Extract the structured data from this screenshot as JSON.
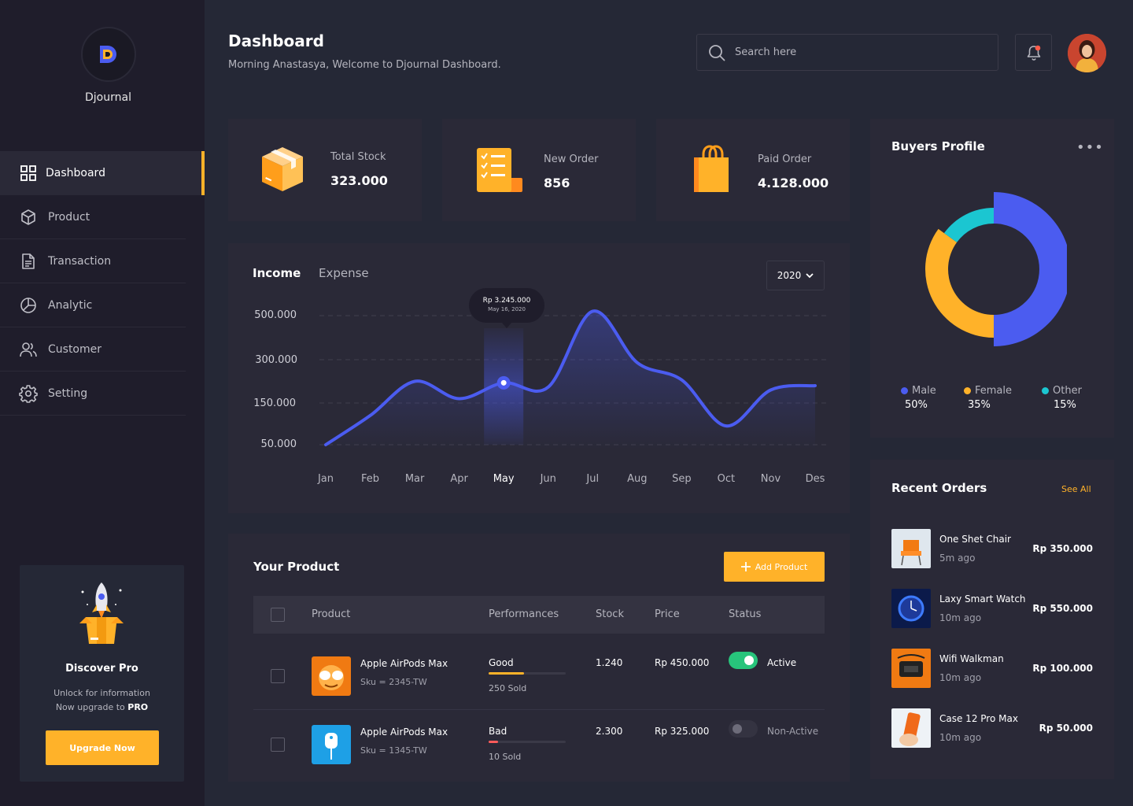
{
  "brand": {
    "name": "Djournal"
  },
  "sidebar": {
    "items": [
      {
        "label": "Dashboard",
        "icon": "grid-icon",
        "active": true
      },
      {
        "label": "Product",
        "icon": "box-icon"
      },
      {
        "label": "Transaction",
        "icon": "document-icon"
      },
      {
        "label": "Analytic",
        "icon": "pie-chart-icon"
      },
      {
        "label": "Customer",
        "icon": "users-icon"
      },
      {
        "label": "Setting",
        "icon": "gear-icon"
      }
    ],
    "promo": {
      "title": "Discover Pro",
      "line1": "Unlock for information",
      "line2_prefix": "Now upgrade to ",
      "line2_bold": "PRO",
      "button": "Upgrade Now"
    }
  },
  "header": {
    "title": "Dashboard",
    "welcome": "Morning Anastasya, Welcome to Djournal  Dashboard.",
    "search_placeholder": "Search here"
  },
  "stats": [
    {
      "label": "Total Stock",
      "value": "323.000",
      "icon": "box-icon"
    },
    {
      "label": "New Order",
      "value": "856",
      "icon": "checklist-icon"
    },
    {
      "label": "Paid Order",
      "value": "4.128.000",
      "icon": "shopping-bag-icon"
    }
  ],
  "income_chart": {
    "tabs": [
      "Income",
      "Expense"
    ],
    "year": "2020",
    "tooltip": {
      "value": "Rp 3.245.000",
      "date": "May 16, 2020"
    }
  },
  "chart_data": {
    "type": "line",
    "categories": [
      "Jan",
      "Feb",
      "Mar",
      "Apr",
      "May",
      "Jun",
      "Jul",
      "Aug",
      "Sep",
      "Oct",
      "Nov",
      "Des"
    ],
    "y_ticks": [
      "500.000",
      "300.000",
      "150.000",
      "50.000"
    ],
    "highlight": "May",
    "values": [
      50000,
      120000,
      225000,
      165000,
      220000,
      205000,
      520000,
      290000,
      230000,
      95000,
      195000,
      210000
    ],
    "grid": true,
    "colors": {
      "line": "#4b5cf0"
    }
  },
  "products": {
    "title": "Your Product",
    "add_button": "Add Product",
    "columns": [
      "Product",
      "Performances",
      "Stock",
      "Price",
      "Status"
    ],
    "rows": [
      {
        "name": "Apple AirPods Max",
        "sku": "Sku = 2345-TW",
        "performance": "Good",
        "performance_fraction": 0.46,
        "bar_color": "#ffb229",
        "sold": "250 Sold",
        "stock": "1.240",
        "price": "Rp 450.000",
        "status": "Active",
        "active": true
      },
      {
        "name": "Apple AirPods Max",
        "sku": "Sku = 1345-TW",
        "performance": "Bad",
        "performance_fraction": 0.12,
        "bar_color": "#ff5b5b",
        "sold": "10 Sold",
        "stock": "2.300",
        "price": "Rp 325.000",
        "status": "Non-Active",
        "active": false
      }
    ]
  },
  "buyers": {
    "title": "Buyers Profile",
    "segments": [
      {
        "label": "Male",
        "value": "50%",
        "percent": 50,
        "color": "#4b5cf0"
      },
      {
        "label": "Female",
        "value": "35%",
        "percent": 35,
        "color": "#ffb229"
      },
      {
        "label": "Other",
        "value": "15%",
        "percent": 15,
        "color": "#1bc6d1"
      }
    ]
  },
  "recent_orders": {
    "title": "Recent Orders",
    "see_all": "See All",
    "items": [
      {
        "name": "One Shet Chair",
        "time": "5m ago",
        "price": "Rp 350.000"
      },
      {
        "name": "Laxy Smart Watch",
        "time": "10m ago",
        "price": "Rp 550.000"
      },
      {
        "name": "Wifi Walkman",
        "time": "10m ago",
        "price": "Rp 100.000"
      },
      {
        "name": "Case 12 Pro Max",
        "time": "10m ago",
        "price": "Rp 50.000"
      }
    ]
  }
}
